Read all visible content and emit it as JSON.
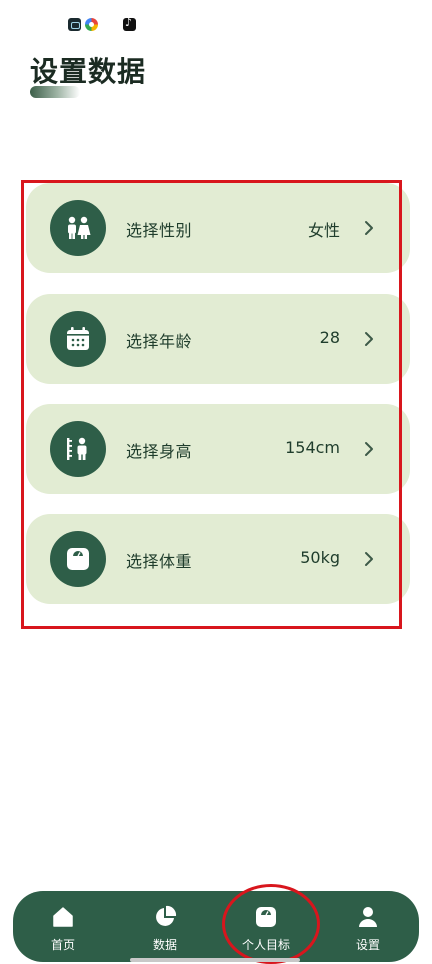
{
  "page": {
    "title": "设置数据"
  },
  "settings": {
    "items": [
      {
        "label": "选择性别",
        "value": "女性",
        "icon": "couple-icon"
      },
      {
        "label": "选择年龄",
        "value": "28",
        "icon": "calendar-icon"
      },
      {
        "label": "选择身高",
        "value": "154cm",
        "icon": "height-icon"
      },
      {
        "label": "选择体重",
        "value": "50kg",
        "icon": "scale-icon"
      }
    ]
  },
  "nav": {
    "items": [
      {
        "label": "首页",
        "icon": "home-icon"
      },
      {
        "label": "数据",
        "icon": "pie-chart-icon"
      },
      {
        "label": "个人目标",
        "icon": "scale-icon",
        "active": true
      },
      {
        "label": "设置",
        "icon": "person-icon"
      }
    ]
  },
  "colors": {
    "primary": "#2e5e48",
    "card_bg": "#e2ecd3",
    "annotation": "#d8161d",
    "active_indicator": "#4ad8a2"
  }
}
